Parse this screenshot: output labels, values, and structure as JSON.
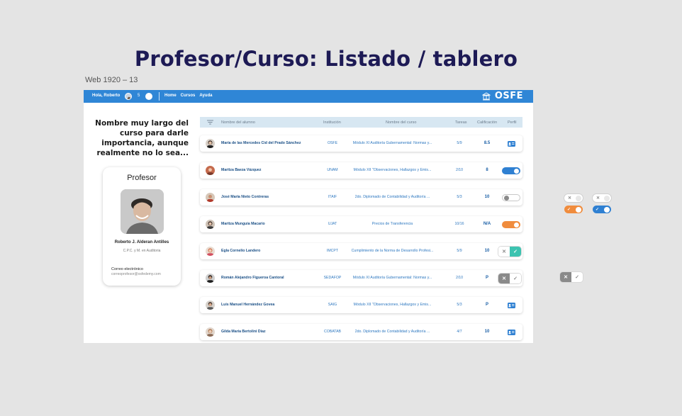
{
  "canvas": {
    "title": "Profesor/Curso: Listado / tablero",
    "frame_label": "Web 1920 – 13"
  },
  "topbar": {
    "greeting": "Hola, Roberto",
    "count": "5",
    "nav": [
      "Home",
      "Cursos",
      "Ayuda"
    ],
    "logo": "OSFE",
    "color": "#2f86d6"
  },
  "course": {
    "title_lines": [
      "Nombre muy largo del",
      "curso para darle",
      "importancia, aunque",
      "realmente no lo sea..."
    ]
  },
  "professor": {
    "heading": "Profesor",
    "name": "Roberto J. Alderan Antilles",
    "degree": "C.P.C. y M. en Auditoria",
    "email_label": "Correo electrónico",
    "email": "correoprofesor@osfedemy.com"
  },
  "table": {
    "headers": {
      "name": "Nombre del alumno",
      "institution": "Institución",
      "course": "Nombre del curso",
      "tasks": "Tareas",
      "grade": "Calificación",
      "profile": "Perfil"
    },
    "rows": [
      {
        "name": "María de las Mercedes Cid del Prado Sánchez",
        "institution": "OSFE",
        "course": "Módulo XI Auditoría Gubernamental: Normas y...",
        "tasks": "5/9",
        "grade": "8.5",
        "perfil": "id-card"
      },
      {
        "name": "Maritza Baeza Vázquez",
        "institution": "UNAM",
        "course": "Módulo XII \"Observaciones, Hallazgos y Emis...",
        "tasks": "2/10",
        "grade": "8",
        "perfil": "toggle-on-blue"
      },
      {
        "name": "José María Nieto Contreras",
        "institution": "ITAIF",
        "course": "2do. Diplomado de Contabilidad y Auditoría ...",
        "tasks": "5/3",
        "grade": "10",
        "perfil": "toggle-off"
      },
      {
        "name": "Maritza Munguía Macario",
        "institution": "UJAT",
        "course": "Precios de Transferencia",
        "tasks": "10/16",
        "grade": "N/A",
        "perfil": "toggle-on-orange"
      },
      {
        "name": "Egla Cornelio Landero",
        "institution": "IMCPT",
        "course": "Cumplimiento de la Norma de Desarrollo Profesi...",
        "tasks": "5/9",
        "grade": "10",
        "perfil": "pill-check-active"
      },
      {
        "name": "Román Alejandro Figueroa Cantoral",
        "institution": "SEDAFOP",
        "course": "Módulo XI Auditoría Gubernamental: Normas y...",
        "tasks": "2/10",
        "grade": "P",
        "perfil": "pill-x-active"
      },
      {
        "name": "Luis Manuel Hernández Govea",
        "institution": "SAIG",
        "course": "Módulo XII \"Observaciones, Hallazgos y Emis...",
        "tasks": "5/3",
        "grade": "P",
        "perfil": "id-card"
      },
      {
        "name": "Gilda María Bertolini Díaz",
        "institution": "COBATAB",
        "course": "2do. Diplomado de Contabilidad y Auditoría ...",
        "tasks": "4/7",
        "grade": "10",
        "perfil": "id-card"
      }
    ]
  },
  "colors": {
    "accent": "#2f80d2",
    "orange": "#f08c3d",
    "teal": "#3cc3b0",
    "title": "#1d1a55"
  }
}
